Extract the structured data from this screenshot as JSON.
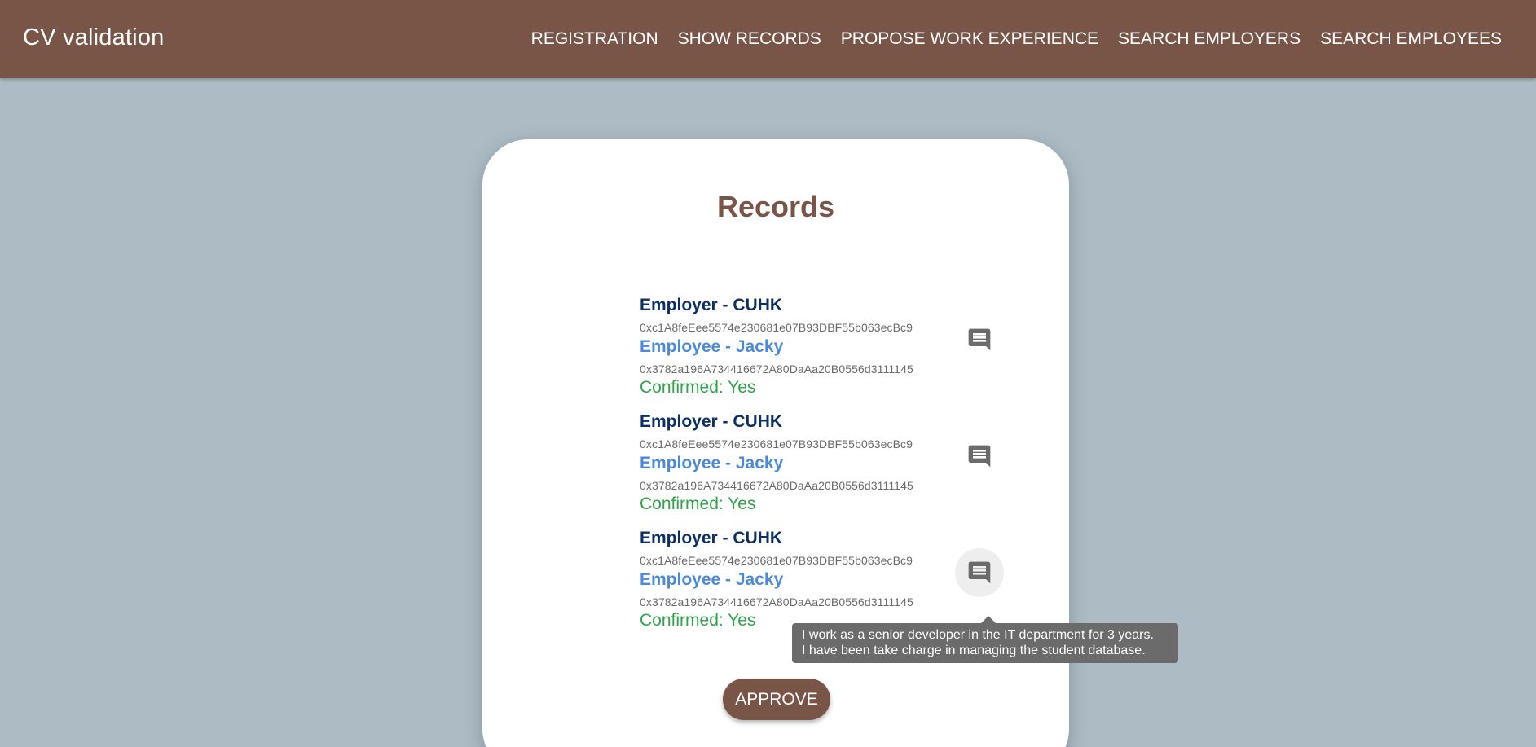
{
  "app": {
    "title": "CV validation"
  },
  "nav": {
    "items": [
      {
        "label": "REGISTRATION"
      },
      {
        "label": "SHOW RECORDS"
      },
      {
        "label": "PROPOSE WORK EXPERIENCE"
      },
      {
        "label": "SEARCH EMPLOYERS"
      },
      {
        "label": "SEARCH EMPLOYEES"
      }
    ]
  },
  "card": {
    "title": "Records",
    "records": [
      {
        "employer": "Employer - CUHK",
        "employer_address": "0xc1A8feEee5574e230681e07B93DBF55b063ecBc9",
        "employee": "Employee - Jacky",
        "employee_address": "0x3782a196A734416672A80DaAa20B0556d3111145",
        "confirmed": "Confirmed: Yes",
        "comment_icon": "comment-icon"
      },
      {
        "employer": "Employer - CUHK",
        "employer_address": "0xc1A8feEee5574e230681e07B93DBF55b063ecBc9",
        "employee": "Employee - Jacky",
        "employee_address": "0x3782a196A734416672A80DaAa20B0556d3111145",
        "confirmed": "Confirmed: Yes",
        "comment_icon": "comment-icon"
      },
      {
        "employer": "Employer - CUHK",
        "employer_address": "0xc1A8feEee5574e230681e07B93DBF55b063ecBc9",
        "employee": "Employee - Jacky",
        "employee_address": "0x3782a196A734416672A80DaAa20B0556d3111145",
        "confirmed": "Confirmed: Yes",
        "comment_icon": "comment-icon"
      }
    ],
    "tooltip": {
      "line1": "I work as a senior developer in the IT department for 3 years.",
      "line2": "I have been take charge in managing the student database."
    },
    "approve_label": "Approve"
  },
  "colors": {
    "appbar": "#795548",
    "background": "#adbcc4",
    "employer_text": "#0d2f64",
    "employee_text": "#4a8ad6",
    "confirmed_text": "#2fa34a"
  }
}
